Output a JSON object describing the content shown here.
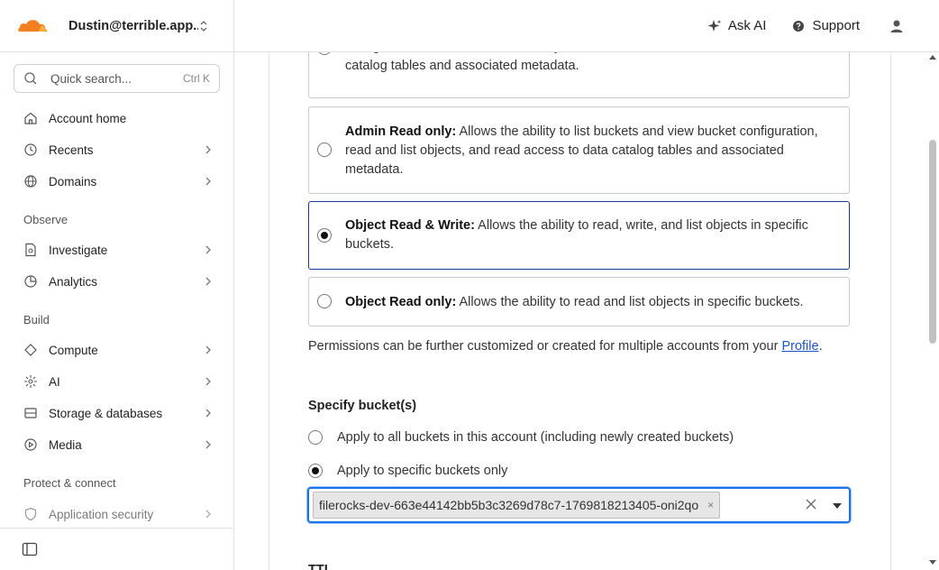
{
  "account": {
    "name": "Dustin@terrible.app..."
  },
  "search": {
    "placeholder": "Quick search...",
    "shortcut": "Ctrl K"
  },
  "sidebar": {
    "items": [
      {
        "label": "Account home"
      },
      {
        "label": "Recents"
      },
      {
        "label": "Domains"
      },
      {
        "label": "Investigate"
      },
      {
        "label": "Analytics"
      },
      {
        "label": "Compute"
      },
      {
        "label": "AI"
      },
      {
        "label": "Storage & databases"
      },
      {
        "label": "Media"
      },
      {
        "label": "Application security"
      }
    ],
    "sections": {
      "observe": "Observe",
      "build": "Build",
      "protect": "Protect & connect"
    }
  },
  "header": {
    "ask_ai": "Ask AI",
    "support": "Support"
  },
  "permissions": {
    "options": [
      {
        "title": "",
        "desc": "configuration, read, write, and list objects, and read and write access to data catalog tables and associated metadata.",
        "selected": false
      },
      {
        "title": "Admin Read only:",
        "desc": " Allows the ability to list buckets and view bucket configuration, read and list objects, and read access to data catalog tables and associated metadata.",
        "selected": false
      },
      {
        "title": "Object Read & Write:",
        "desc": " Allows the ability to read, write, and list objects in specific buckets.",
        "selected": true
      },
      {
        "title": "Object Read only:",
        "desc": " Allows the ability to read and list objects in specific buckets.",
        "selected": false
      }
    ],
    "note_prefix": "Permissions can be further customized or created for multiple accounts from your ",
    "note_link": "Profile",
    "note_suffix": "."
  },
  "buckets": {
    "heading": "Specify bucket(s)",
    "all_label": "Apply to all buckets in this account (including newly created buckets)",
    "specific_label": "Apply to specific buckets only",
    "selected_bucket": "filerocks-dev-663e44142bb5b3c3269d78c7-1769818213405-oni2qo",
    "chip_remove": "×"
  },
  "ttl": {
    "heading": "TTL"
  },
  "colors": {
    "accent": "#1a73e8",
    "selected_border": "#1a3b8f",
    "link": "#1a56c9",
    "logo": "#f38020"
  }
}
